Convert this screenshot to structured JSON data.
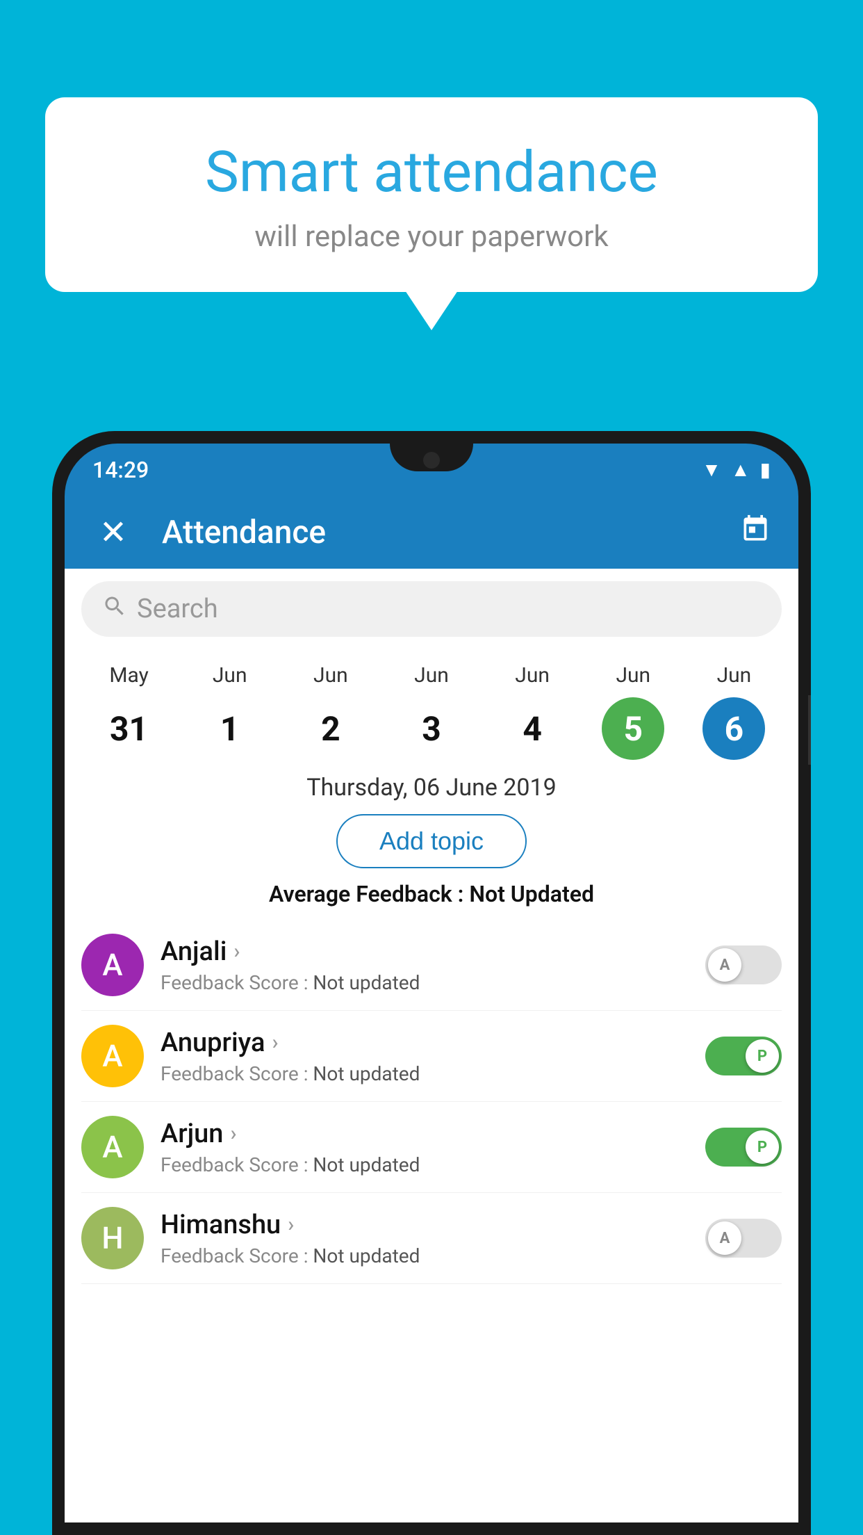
{
  "background_color": "#00b4d8",
  "speech_bubble": {
    "title": "Smart attendance",
    "subtitle": "will replace your paperwork"
  },
  "status_bar": {
    "time": "14:29"
  },
  "app_header": {
    "title": "Attendance",
    "close_label": "✕",
    "calendar_label": "📅"
  },
  "search": {
    "placeholder": "Search"
  },
  "dates": [
    {
      "month": "May",
      "day": "31",
      "style": "normal"
    },
    {
      "month": "Jun",
      "day": "1",
      "style": "normal"
    },
    {
      "month": "Jun",
      "day": "2",
      "style": "normal"
    },
    {
      "month": "Jun",
      "day": "3",
      "style": "normal"
    },
    {
      "month": "Jun",
      "day": "4",
      "style": "normal"
    },
    {
      "month": "Jun",
      "day": "5",
      "style": "today"
    },
    {
      "month": "Jun",
      "day": "6",
      "style": "selected"
    }
  ],
  "selected_date_label": "Thursday, 06 June 2019",
  "add_topic_label": "Add topic",
  "avg_feedback": {
    "label": "Average Feedback : ",
    "value": "Not Updated"
  },
  "students": [
    {
      "name": "Anjali",
      "feedback_label": "Feedback Score : ",
      "feedback_value": "Not updated",
      "avatar_letter": "A",
      "avatar_color": "purple",
      "toggle_state": "off",
      "toggle_label": "A"
    },
    {
      "name": "Anupriya",
      "feedback_label": "Feedback Score : ",
      "feedback_value": "Not updated",
      "avatar_letter": "A",
      "avatar_color": "amber",
      "toggle_state": "on",
      "toggle_label": "P"
    },
    {
      "name": "Arjun",
      "feedback_label": "Feedback Score : ",
      "feedback_value": "Not updated",
      "avatar_letter": "A",
      "avatar_color": "green",
      "toggle_state": "on",
      "toggle_label": "P"
    },
    {
      "name": "Himanshu",
      "feedback_label": "Feedback Score : ",
      "feedback_value": "Not updated",
      "avatar_letter": "H",
      "avatar_color": "lime",
      "toggle_state": "off",
      "toggle_label": "A"
    }
  ]
}
